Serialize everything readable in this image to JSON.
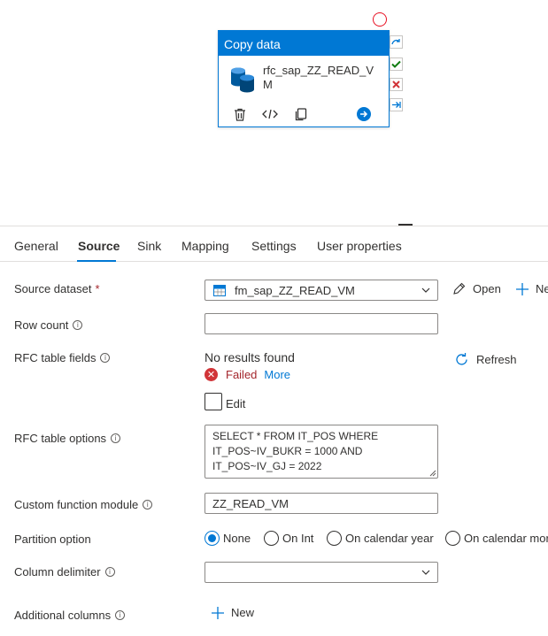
{
  "activity": {
    "header": "Copy data",
    "name": "rfc_sap_ZZ_READ_VM"
  },
  "tabs": [
    {
      "label": "General"
    },
    {
      "label": "Source"
    },
    {
      "label": "Sink"
    },
    {
      "label": "Mapping"
    },
    {
      "label": "Settings"
    },
    {
      "label": "User properties"
    }
  ],
  "source_dataset": {
    "label": "Source dataset",
    "required_mark": "*",
    "value": "fm_sap_ZZ_READ_VM",
    "open_label": "Open",
    "new_label": "Ne"
  },
  "row_count": {
    "label": "Row count",
    "value": ""
  },
  "rfc_table_fields": {
    "label": "RFC table fields",
    "no_results": "No results found",
    "status": "Failed",
    "more_link": "More",
    "refresh_label": "Refresh",
    "edit_label": "Edit",
    "edit_checked": false
  },
  "rfc_table_options": {
    "label": "RFC table options",
    "lines": [
      "SELECT * FROM IT_POS WHERE",
      "IT_POS~IV_BUKR = 1000 AND",
      "IT_POS~IV_GJ = 2022"
    ]
  },
  "custom_function_module": {
    "label": "Custom function module",
    "value": "ZZ_READ_VM"
  },
  "partition_option": {
    "label": "Partition option",
    "options": [
      "None",
      "On Int",
      "On calendar year",
      "On calendar mor"
    ],
    "selected": "None"
  },
  "column_delimiter": {
    "label": "Column delimiter",
    "value": ""
  },
  "additional_columns": {
    "label": "Additional columns",
    "new_label": "New"
  },
  "colors": {
    "accent": "#0078d4",
    "error": "#d13438",
    "success": "#107c10"
  }
}
